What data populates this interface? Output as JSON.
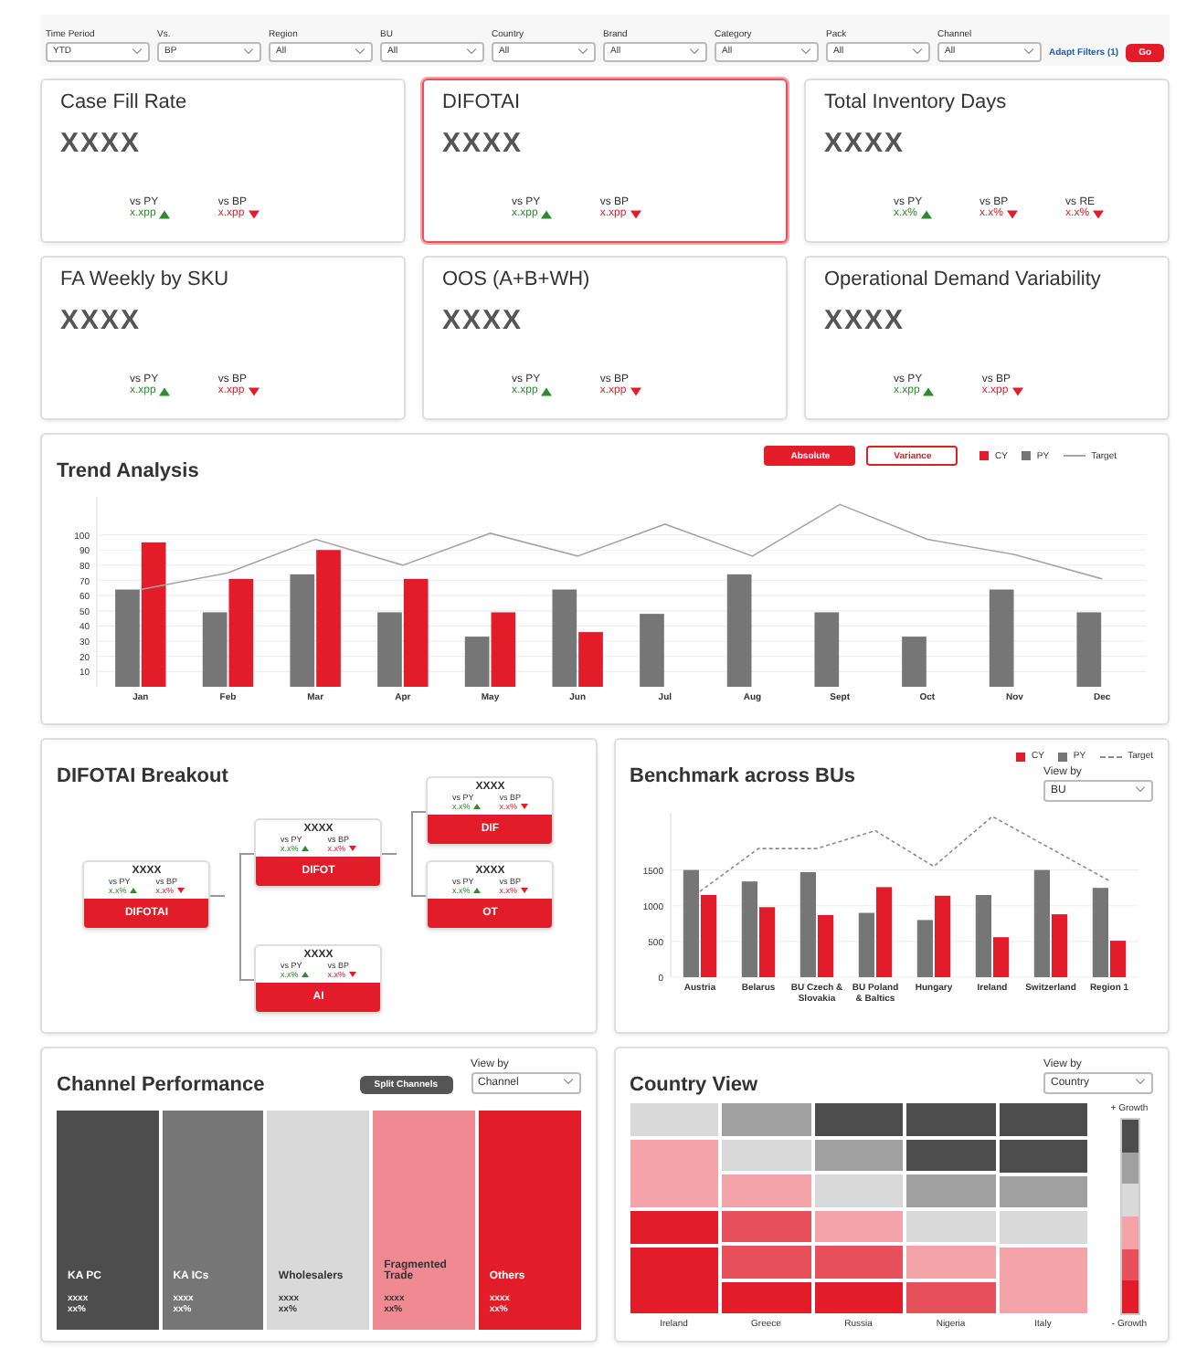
{
  "filters": [
    {
      "label": "Time Period",
      "value": "YTD"
    },
    {
      "label": "Vs.",
      "value": "BP"
    },
    {
      "label": "Region",
      "value": "All"
    },
    {
      "label": "BU",
      "value": "All"
    },
    {
      "label": "Country",
      "value": "All"
    },
    {
      "label": "Brand",
      "value": "All"
    },
    {
      "label": "Category",
      "value": "All"
    },
    {
      "label": "Pack",
      "value": "All"
    },
    {
      "label": "Channel",
      "value": "All"
    }
  ],
  "adapt_filters_link": "Adapt Filters (1)",
  "go_button": "Go",
  "kpis": [
    {
      "title": "Case Fill Rate",
      "value": "XXXX",
      "selected": false,
      "comparisons": [
        {
          "label": "vs PY",
          "value": "x.xpp",
          "up": true
        },
        {
          "label": "vs BP",
          "value": "x.xpp",
          "up": false
        }
      ]
    },
    {
      "title": "DIFOTAI",
      "value": "XXXX",
      "selected": true,
      "comparisons": [
        {
          "label": "vs PY",
          "value": "x.xpp",
          "up": true
        },
        {
          "label": "vs BP",
          "value": "x.xpp",
          "up": false
        }
      ]
    },
    {
      "title": "Total Inventory Days",
      "value": "XXXX",
      "selected": false,
      "comparisons": [
        {
          "label": "vs PY",
          "value": "x.x%",
          "up": true
        },
        {
          "label": "vs BP",
          "value": "x.x%",
          "up": false
        },
        {
          "label": "vs RE",
          "value": "x.x%",
          "up": false
        }
      ]
    },
    {
      "title": "FA Weekly by SKU",
      "value": "XXXX",
      "selected": false,
      "comparisons": [
        {
          "label": "vs PY",
          "value": "x.xpp",
          "up": true
        },
        {
          "label": "vs BP",
          "value": "x.xpp",
          "up": false
        }
      ]
    },
    {
      "title": "OOS (A+B+WH)",
      "value": "XXXX",
      "selected": false,
      "comparisons": [
        {
          "label": "vs PY",
          "value": "x.xpp",
          "up": true
        },
        {
          "label": "vs BP",
          "value": "x.xpp",
          "up": false
        }
      ]
    },
    {
      "title": "Operational Demand Variability",
      "value": "XXXX",
      "selected": false,
      "comparisons": [
        {
          "label": "vs PY",
          "value": "x.xpp",
          "up": true
        },
        {
          "label": "vs BP",
          "value": "x.xpp",
          "up": false
        }
      ]
    }
  ],
  "trend_analysis": {
    "title": "Trend Analysis",
    "toggles": [
      {
        "label": "Absolute",
        "selected": true
      },
      {
        "label": "Variance",
        "selected": false
      }
    ],
    "chart_data": {
      "type": "bar",
      "categories": [
        "Jan",
        "Feb",
        "Mar",
        "Apr",
        "May",
        "Jun",
        "Jul",
        "Aug",
        "Sept",
        "Oct",
        "Nov",
        "Dec"
      ],
      "ylim": [
        0,
        125
      ],
      "yticks": [
        10,
        20,
        30,
        40,
        50,
        60,
        70,
        80,
        90,
        100
      ],
      "stacked": false,
      "grid": true,
      "series": [
        {
          "name": "CY",
          "color": "#e31c2a",
          "values": [
            95,
            71,
            90,
            71,
            49,
            36,
            null,
            null,
            null,
            null,
            null,
            null
          ]
        },
        {
          "name": "PY",
          "color": "#767676",
          "values": [
            64,
            49,
            74,
            49,
            33,
            64,
            48,
            74,
            49,
            33,
            64,
            49
          ]
        },
        {
          "name": "Target",
          "color": "#a6a6a6",
          "type": "line",
          "line_style": "solid",
          "values": [
            64,
            75,
            97,
            80,
            101,
            86,
            107,
            86,
            120,
            97,
            87,
            71
          ]
        }
      ]
    }
  },
  "difotai_breakout": {
    "title": "DIFOTAI Breakout",
    "tree": {
      "label": "DIFOTAI",
      "value": "XXXX",
      "comparisons": [
        {
          "label": "vs PY",
          "value": "x.x%",
          "up": true
        },
        {
          "label": "vs BP",
          "value": "x.x%",
          "up": false
        }
      ],
      "children": [
        {
          "label": "DIFOT",
          "value": "XXXX",
          "comparisons": [
            {
              "label": "vs PY",
              "value": "x.x%",
              "up": true
            },
            {
              "label": "vs BP",
              "value": "x.x%",
              "up": false
            }
          ],
          "children": [
            {
              "label": "DIF",
              "value": "XXXX",
              "comparisons": [
                {
                  "label": "vs PY",
                  "value": "x.x%",
                  "up": true
                },
                {
                  "label": "vs BP",
                  "value": "x.x%",
                  "up": false
                }
              ]
            },
            {
              "label": "OT",
              "value": "XXXX",
              "comparisons": [
                {
                  "label": "vs PY",
                  "value": "x.x%",
                  "up": true
                },
                {
                  "label": "vs BP",
                  "value": "x.x%",
                  "up": false
                }
              ]
            }
          ]
        },
        {
          "label": "AI",
          "value": "XXXX",
          "comparisons": [
            {
              "label": "vs PY",
              "value": "x.x%",
              "up": true
            },
            {
              "label": "vs BP",
              "value": "x.x%",
              "up": false
            }
          ]
        }
      ]
    }
  },
  "benchmark": {
    "title": "Benchmark across BUs",
    "view_by": {
      "label": "View by",
      "value": "BU"
    },
    "chart_data": {
      "type": "bar",
      "categories": [
        "Austria",
        "Belarus",
        "BU Czech & Slovakia",
        "BU Poland & Baltics",
        "Hungary",
        "Ireland",
        "Switzerland",
        "Region 1"
      ],
      "ylim": [
        0,
        2300
      ],
      "yticks": [
        0,
        500,
        1000,
        1500
      ],
      "stacked": false,
      "grid": true,
      "series": [
        {
          "name": "CY",
          "color": "#e31c2a",
          "values": [
            1150,
            980,
            870,
            1260,
            1140,
            560,
            880,
            510
          ]
        },
        {
          "name": "PY",
          "color": "#767676",
          "values": [
            1500,
            1340,
            1470,
            900,
            800,
            1150,
            1500,
            1250
          ]
        },
        {
          "name": "Target",
          "color": "#8c8c8c",
          "type": "line",
          "line_style": "dashed",
          "values": [
            1200,
            1800,
            1800,
            2050,
            1550,
            2250,
            1800,
            1350
          ]
        }
      ]
    }
  },
  "channel_performance": {
    "title": "Channel Performance",
    "split_button": "Split Channels",
    "view_by": {
      "label": "View by",
      "value": "Channel"
    },
    "segments": [
      {
        "name": "KA PC",
        "value": "xxxx",
        "share": "xx%",
        "color": "#4d4d4d"
      },
      {
        "name": "KA ICs",
        "value": "xxxx",
        "share": "xx%",
        "color": "#767676"
      },
      {
        "name": "Wholesalers",
        "value": "xxxx",
        "share": "xx%",
        "color": "#d9d9d9"
      },
      {
        "name": "Fragmented Trade",
        "value": "xxxx",
        "share": "xx%",
        "color": "#f08a92"
      },
      {
        "name": "Others",
        "value": "xxxx",
        "share": "xx%",
        "color": "#e31c2a"
      }
    ]
  },
  "country_view": {
    "title": "Country View",
    "view_by": {
      "label": "View by",
      "value": "Country"
    },
    "columns": [
      {
        "name": "Ireland",
        "cells": [
          {
            "color": "#d9d9d9",
            "kind": "single"
          },
          {
            "color": "#f4a3a9",
            "kind": "double"
          },
          {
            "color": "#e31c2a",
            "kind": "single"
          },
          {
            "color": "#e31c2a",
            "kind": "double"
          }
        ]
      },
      {
        "name": "Greece",
        "cells": [
          {
            "color": "#a0a0a0",
            "kind": "single"
          },
          {
            "color": "#d9d9d9",
            "kind": "single"
          },
          {
            "color": "#f4a3a9",
            "kind": "single"
          },
          {
            "color": "#e8505b",
            "kind": "single"
          },
          {
            "color": "#e8505b",
            "kind": "single"
          },
          {
            "color": "#e31c2a",
            "kind": "single"
          }
        ]
      },
      {
        "name": "Russia",
        "cells": [
          {
            "color": "#4d4d4d",
            "kind": "single"
          },
          {
            "color": "#a0a0a0",
            "kind": "single"
          },
          {
            "color": "#d9d9d9",
            "kind": "single"
          },
          {
            "color": "#f4a3a9",
            "kind": "single"
          },
          {
            "color": "#e8505b",
            "kind": "single"
          },
          {
            "color": "#e31c2a",
            "kind": "single"
          }
        ]
      },
      {
        "name": "Nigeria",
        "cells": [
          {
            "color": "#4d4d4d",
            "kind": "single"
          },
          {
            "color": "#4d4d4d",
            "kind": "single"
          },
          {
            "color": "#a0a0a0",
            "kind": "single"
          },
          {
            "color": "#d9d9d9",
            "kind": "single"
          },
          {
            "color": "#f4a3a9",
            "kind": "single"
          },
          {
            "color": "#e8505b",
            "kind": "single"
          }
        ]
      },
      {
        "name": "Italy",
        "cells": [
          {
            "color": "#4d4d4d",
            "kind": "single"
          },
          {
            "color": "#4d4d4d",
            "kind": "single"
          },
          {
            "color": "#a0a0a0",
            "kind": "single"
          },
          {
            "color": "#d9d9d9",
            "kind": "single"
          },
          {
            "color": "#f4a3a9",
            "kind": "double"
          }
        ]
      }
    ],
    "legend": {
      "top_label": "+ Growth",
      "bottom_label": "- Growth",
      "steps": [
        {
          "color": "#4d4d4d"
        },
        {
          "color": "#a0a0a0"
        },
        {
          "color": "#d9d9d9"
        },
        {
          "color": "#f4a3a9"
        },
        {
          "color": "#e8505b"
        },
        {
          "color": "#e31c2a"
        }
      ]
    }
  }
}
